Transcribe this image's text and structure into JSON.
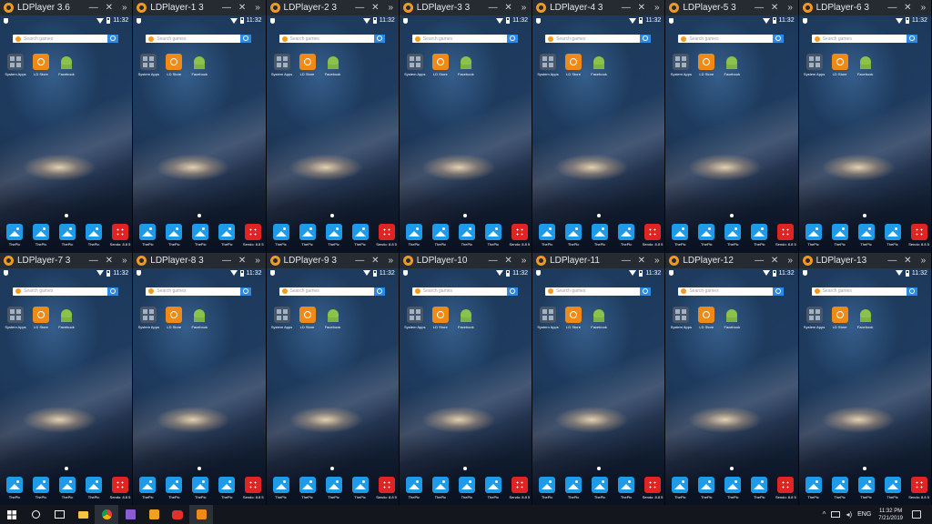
{
  "instances": [
    {
      "title": "LDPlayer 3.6"
    },
    {
      "title": "LDPlayer-1 3"
    },
    {
      "title": "LDPlayer-2 3"
    },
    {
      "title": "LDPlayer-3 3"
    },
    {
      "title": "LDPlayer-4 3"
    },
    {
      "title": "LDPlayer-5 3"
    },
    {
      "title": "LDPlayer-6 3"
    },
    {
      "title": "LDPlayer-7 3"
    },
    {
      "title": "LDPlayer-8 3"
    },
    {
      "title": "LDPlayer-9 3"
    },
    {
      "title": "LDPlayer-10"
    },
    {
      "title": "LDPlayer-11"
    },
    {
      "title": "LDPlayer-12"
    },
    {
      "title": "LDPlayer-13"
    }
  ],
  "window_controls": {
    "minimize": "—",
    "close": "✕",
    "more": "»"
  },
  "status_time": "11:32",
  "search_placeholder": "Search games",
  "home_apps": [
    "System Apps",
    "LD Store",
    "Facebook"
  ],
  "dock_apps": [
    "ThePic",
    "ThePic",
    "ThePic",
    "ThePic",
    "Sendo: 8.8 5"
  ],
  "taskbar": {
    "tray_lang": "ENG",
    "time": "11:32 PM",
    "date": "7/21/2019",
    "up_arrow": "^",
    "volume": "◂)"
  },
  "icons": {
    "app": "ldplayer-logo-icon",
    "status_left": "shield-icon",
    "wifi": "wifi-icon",
    "battery": "battery-icon"
  },
  "colors": {
    "accent_orange": "#f39a1e",
    "search_button": "#2d8ae0",
    "titlebar": "#262a31",
    "taskbar": "#13161c"
  }
}
